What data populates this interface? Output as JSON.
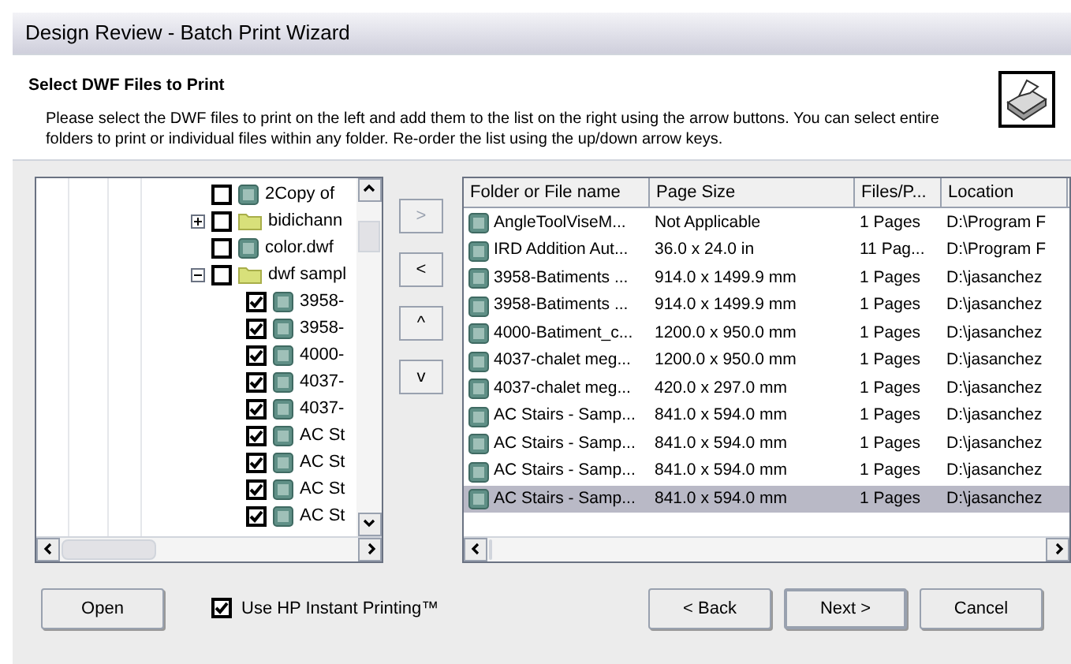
{
  "window": {
    "title": "Design Review - Batch Print Wizard"
  },
  "header": {
    "heading": "Select DWF Files to Print",
    "description": "Please select the DWF files to print on the left and add them to the list on the right using the arrow buttons.  You can select entire folders to print or individual files within any folder.  Re-order the list using the up/down arrow keys."
  },
  "tree": [
    {
      "kind": "file",
      "label": "2Copy of",
      "checked": false
    },
    {
      "kind": "folder",
      "label": "bidichann",
      "checked": false,
      "expanded": false
    },
    {
      "kind": "file",
      "label": "color.dwf",
      "checked": false
    },
    {
      "kind": "folder",
      "label": "dwf sampl",
      "checked": false,
      "expanded": true,
      "children": [
        {
          "kind": "file",
          "label": "3958-",
          "checked": true
        },
        {
          "kind": "file",
          "label": "3958-",
          "checked": true
        },
        {
          "kind": "file",
          "label": "4000-",
          "checked": true
        },
        {
          "kind": "file",
          "label": "4037-",
          "checked": true
        },
        {
          "kind": "file",
          "label": "4037-",
          "checked": true
        },
        {
          "kind": "file",
          "label": "AC St",
          "checked": true
        },
        {
          "kind": "file",
          "label": "AC St",
          "checked": true
        },
        {
          "kind": "file",
          "label": "AC St",
          "checked": true
        },
        {
          "kind": "file",
          "label": "AC St",
          "checked": true
        }
      ]
    }
  ],
  "move_buttons": [
    {
      "label": ">",
      "disabled": true
    },
    {
      "label": "<",
      "disabled": false
    },
    {
      "label": "^",
      "disabled": false
    },
    {
      "label": "v",
      "disabled": false
    }
  ],
  "table": {
    "columns": [
      "Folder or File name",
      "Page Size",
      "Files/P...",
      "Location"
    ],
    "rows": [
      {
        "cells": [
          "AngleToolViseM...",
          "Not Applicable",
          "1 Pages",
          "D:\\Program F"
        ],
        "selected": false
      },
      {
        "cells": [
          "IRD Addition Aut...",
          "36.0 x 24.0 in",
          "11 Pag...",
          "D:\\Program F"
        ],
        "selected": false
      },
      {
        "cells": [
          "3958-Batiments ...",
          "914.0 x 1499.9 mm",
          "1 Pages",
          "D:\\jasanchez"
        ],
        "selected": false
      },
      {
        "cells": [
          "3958-Batiments ...",
          "914.0 x 1499.9 mm",
          "1 Pages",
          "D:\\jasanchez"
        ],
        "selected": false
      },
      {
        "cells": [
          "4000-Batiment_c...",
          "1200.0 x 950.0 mm",
          "1 Pages",
          "D:\\jasanchez"
        ],
        "selected": false
      },
      {
        "cells": [
          "4037-chalet meg...",
          "1200.0 x 950.0 mm",
          "1 Pages",
          "D:\\jasanchez"
        ],
        "selected": false
      },
      {
        "cells": [
          "4037-chalet meg...",
          "420.0 x 297.0 mm",
          "1 Pages",
          "D:\\jasanchez"
        ],
        "selected": false
      },
      {
        "cells": [
          "AC Stairs - Samp...",
          "841.0 x 594.0 mm",
          "1 Pages",
          "D:\\jasanchez"
        ],
        "selected": false
      },
      {
        "cells": [
          "AC Stairs - Samp...",
          "841.0 x 594.0 mm",
          "1 Pages",
          "D:\\jasanchez"
        ],
        "selected": false
      },
      {
        "cells": [
          "AC Stairs - Samp...",
          "841.0 x 594.0 mm",
          "1 Pages",
          "D:\\jasanchez"
        ],
        "selected": false
      },
      {
        "cells": [
          "AC Stairs - Samp...",
          "841.0 x 594.0 mm",
          "1 Pages",
          "D:\\jasanchez"
        ],
        "selected": true
      }
    ]
  },
  "footer": {
    "open_button": "Open",
    "instant_printing": {
      "label": "Use HP Instant Printing™",
      "checked": true
    },
    "buttons": [
      "< Back",
      "Next >",
      "Cancel"
    ]
  }
}
